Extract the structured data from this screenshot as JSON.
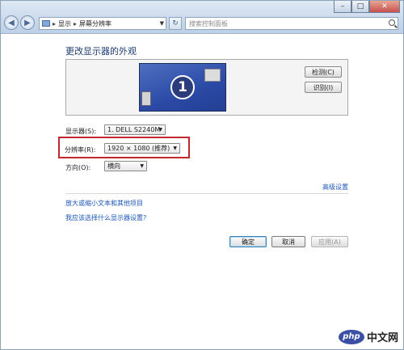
{
  "window": {
    "caption_buttons": {
      "minimize": "–",
      "maximize": "□",
      "close": "✕"
    },
    "nav": {
      "back": "◀",
      "forward": "▶"
    },
    "breadcrumb": [
      "显示",
      "屏幕分辨率"
    ],
    "breadcrumb_separator": "▸",
    "dropdown_arrow": "▼",
    "refresh": "↻",
    "search_placeholder": "搜索控制面板"
  },
  "page": {
    "title": "更改显示器的外观",
    "monitor_number": "1",
    "detect_button": "检测(C)",
    "identify_button": "识别(I)"
  },
  "settings": {
    "display_label": "显示器(S):",
    "display_value": "1. DELL S2240M",
    "resolution_label": "分辨率(R):",
    "resolution_value": "1920 × 1080 (推荐)",
    "orientation_label": "方向(O):",
    "orientation_value": "横向",
    "select_arrow": "▼"
  },
  "links": {
    "advanced": "高级设置",
    "enlarge_text": "放大或缩小文本和其他项目",
    "which_settings": "我应该选择什么显示器设置?"
  },
  "buttons": {
    "ok": "确定",
    "cancel": "取消",
    "apply": "应用(A)"
  },
  "watermark": {
    "logo": "php",
    "text": "中文网"
  },
  "colors": {
    "highlight": "#c0282e",
    "link": "#1a56b8",
    "title": "#1e3a72"
  }
}
